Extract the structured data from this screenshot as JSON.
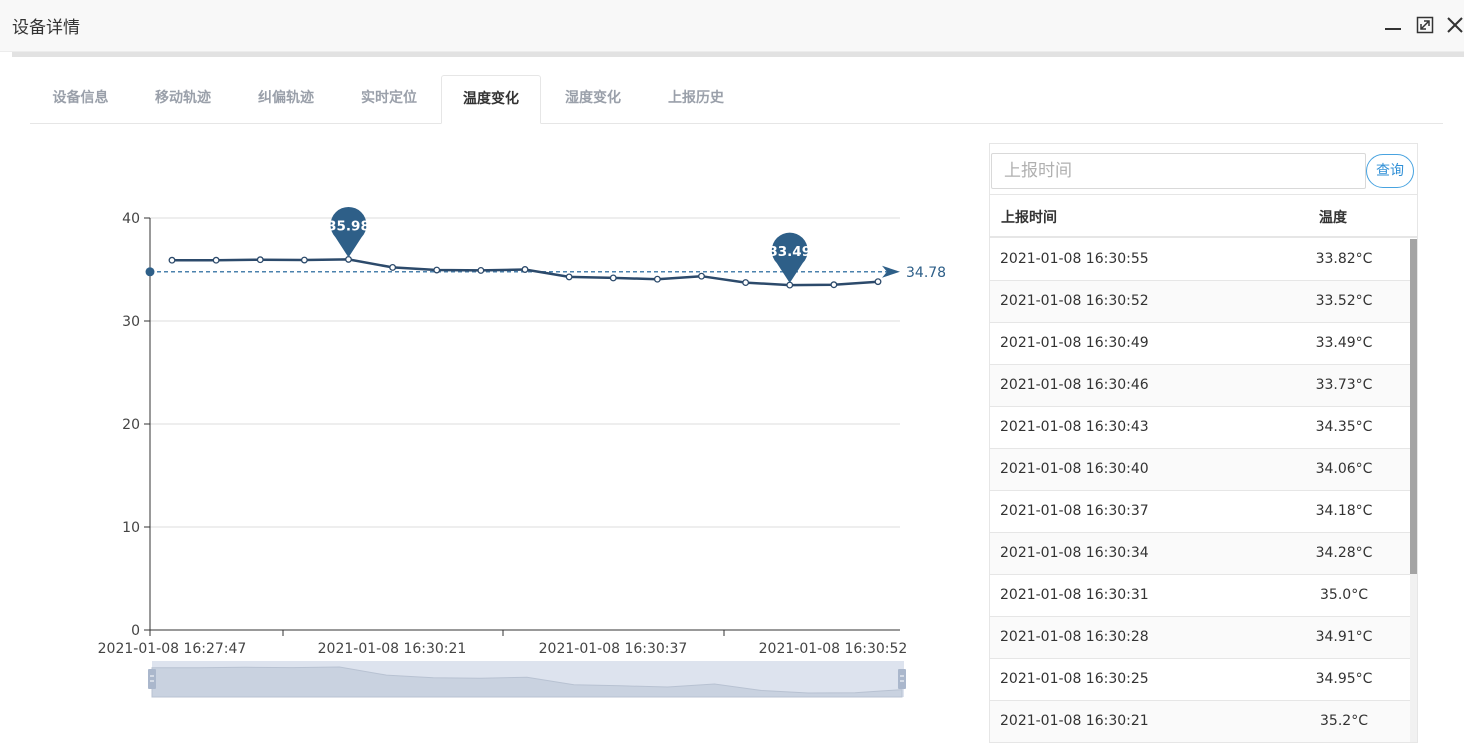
{
  "window": {
    "title": "设备详情"
  },
  "tabs": [
    {
      "label": "设备信息",
      "active": false
    },
    {
      "label": "移动轨迹",
      "active": false
    },
    {
      "label": "纠偏轨迹",
      "active": false
    },
    {
      "label": "实时定位",
      "active": false
    },
    {
      "label": "温度变化",
      "active": true
    },
    {
      "label": "湿度变化",
      "active": false
    },
    {
      "label": "上报历史",
      "active": false
    }
  ],
  "search": {
    "placeholder": "上报时间",
    "value": "",
    "button_label": "查询"
  },
  "table": {
    "headers": [
      "上报时间",
      "温度"
    ],
    "rows": [
      {
        "time": "2021-01-08 16:30:55",
        "temp": "33.82°C"
      },
      {
        "time": "2021-01-08 16:30:52",
        "temp": "33.52°C"
      },
      {
        "time": "2021-01-08 16:30:49",
        "temp": "33.49°C"
      },
      {
        "time": "2021-01-08 16:30:46",
        "temp": "33.73°C"
      },
      {
        "time": "2021-01-08 16:30:43",
        "temp": "34.35°C"
      },
      {
        "time": "2021-01-08 16:30:40",
        "temp": "34.06°C"
      },
      {
        "time": "2021-01-08 16:30:37",
        "temp": "34.18°C"
      },
      {
        "time": "2021-01-08 16:30:34",
        "temp": "34.28°C"
      },
      {
        "time": "2021-01-08 16:30:31",
        "temp": "35.0°C"
      },
      {
        "time": "2021-01-08 16:30:28",
        "temp": "34.91°C"
      },
      {
        "time": "2021-01-08 16:30:25",
        "temp": "34.95°C"
      },
      {
        "time": "2021-01-08 16:30:21",
        "temp": "35.2°C"
      }
    ]
  },
  "colors": {
    "line": "#2c4a6b",
    "marker": "#2e5f88",
    "average": "#4b82ad",
    "grid": "#dddddd",
    "accent": "#48a3e0"
  },
  "chart_data": {
    "type": "line",
    "title": "",
    "xlabel": "",
    "ylabel": "",
    "ylim": [
      0,
      40
    ],
    "yticks": [
      0,
      10,
      20,
      30,
      40
    ],
    "xtick_labels": [
      "2021-01-08 16:27:47",
      "2021-01-08 16:30:21",
      "2021-01-08 16:30:37",
      "2021-01-08 16:30:52"
    ],
    "values": [
      35.9,
      35.9,
      35.95,
      35.92,
      35.98,
      35.2,
      34.95,
      34.91,
      35.0,
      34.28,
      34.18,
      34.06,
      34.35,
      33.73,
      33.49,
      33.52,
      33.82
    ],
    "max": {
      "value": 35.98,
      "label": "35.98"
    },
    "min": {
      "value": 33.49,
      "label": "33.49"
    },
    "average": {
      "value": 34.78,
      "label": "34.78"
    },
    "grid": true,
    "legend": "none",
    "datazoom": true
  }
}
